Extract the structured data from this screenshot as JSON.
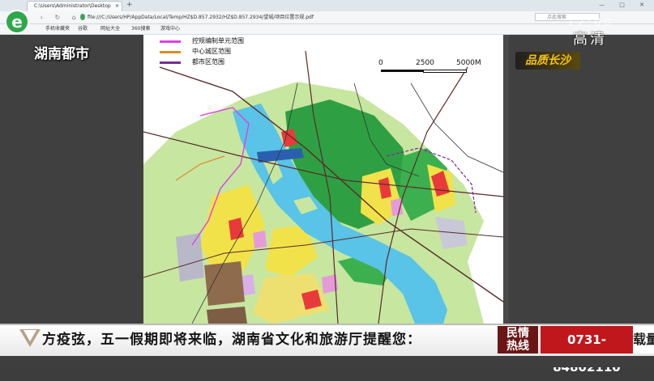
{
  "browser": {
    "tab_title": "C:\\Users\\Administrator\\Desktop",
    "tab_close": "×",
    "new_tab": "+",
    "window_controls": "— □ ✕",
    "nav": "‹ › ↻ ⌂",
    "url": "file:///C:/Users/HP/AppData/Local/Temp/HZ$D.857.2932/HZ$D.857.2934/望城/项目位置示规.pdf",
    "search_placeholder": "点此搜索",
    "bookmarks": [
      "收藏",
      "手机收藏夹",
      "谷歌",
      "网址大全",
      "360搜索",
      "游戏中心"
    ]
  },
  "pdf": {
    "legend": [
      {
        "label": "控规编制单元范围",
        "color": "#e040e0"
      },
      {
        "label": "中心城区范围",
        "color": "#e08a28"
      },
      {
        "label": "都市区范围",
        "color": "#7a2a9a"
      }
    ],
    "scale": {
      "zero": "0",
      "mid": "2500",
      "end": "5000M"
    }
  },
  "overlay": {
    "channel_logo_glyph": "e",
    "channel_name": "湖南都市",
    "clock": "1 2 : 0 0",
    "quality": "高清",
    "program_logo": "品质长沙",
    "ticker_text": "方疫弦，五一假期即将来临，湖南省文化和旅游厅提醒您：",
    "hotline_label_line1": "民情",
    "hotline_label_line2": "热线",
    "hotline_number": "0731-84802110",
    "ticker_tail": "载量"
  },
  "colors": {
    "river": "#59c3e8",
    "green_zone": "#2ea043",
    "light_green": "#b8e08a",
    "residential": "#f2e24a",
    "commercial": "#e83a3a",
    "industrial": "#8f6b4e",
    "public": "#e59bd8",
    "hotline_red": "#c0171d"
  }
}
